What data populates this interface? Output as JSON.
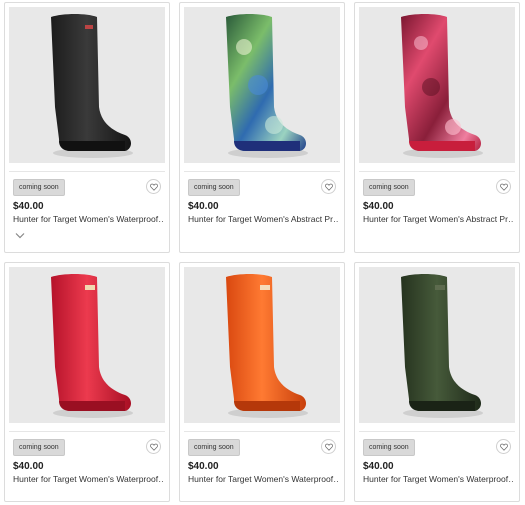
{
  "products": [
    {
      "badge": "coming soon",
      "price": "$40.00",
      "title": "Hunter for Target Women's Waterproof…",
      "color": "#2b2b2b",
      "image": "black-rain-boot"
    },
    {
      "badge": "coming soon",
      "price": "$40.00",
      "title": "Hunter for Target Women's Abstract Pr…",
      "color": "#3a6b3f",
      "image": "abstract-print-green-blue-rain-boot"
    },
    {
      "badge": "coming soon",
      "price": "$40.00",
      "title": "Hunter for Target Women's Abstract Pr…",
      "color": "#b3314d",
      "image": "abstract-print-red-pink-rain-boot"
    },
    {
      "badge": "coming soon",
      "price": "$40.00",
      "title": "Hunter for Target Women's Waterproof…",
      "color": "#d6293a",
      "image": "red-rain-boot"
    },
    {
      "badge": "coming soon",
      "price": "$40.00",
      "title": "Hunter for Target Women's Waterproof…",
      "color": "#f0601f",
      "image": "orange-rain-boot"
    },
    {
      "badge": "coming soon",
      "price": "$40.00",
      "title": "Hunter for Target Women's Waterproof…",
      "color": "#34452e",
      "image": "olive-green-rain-boot"
    }
  ],
  "icons": {
    "favorite": "heart-outline-icon",
    "expand": "chevron-down-icon"
  }
}
